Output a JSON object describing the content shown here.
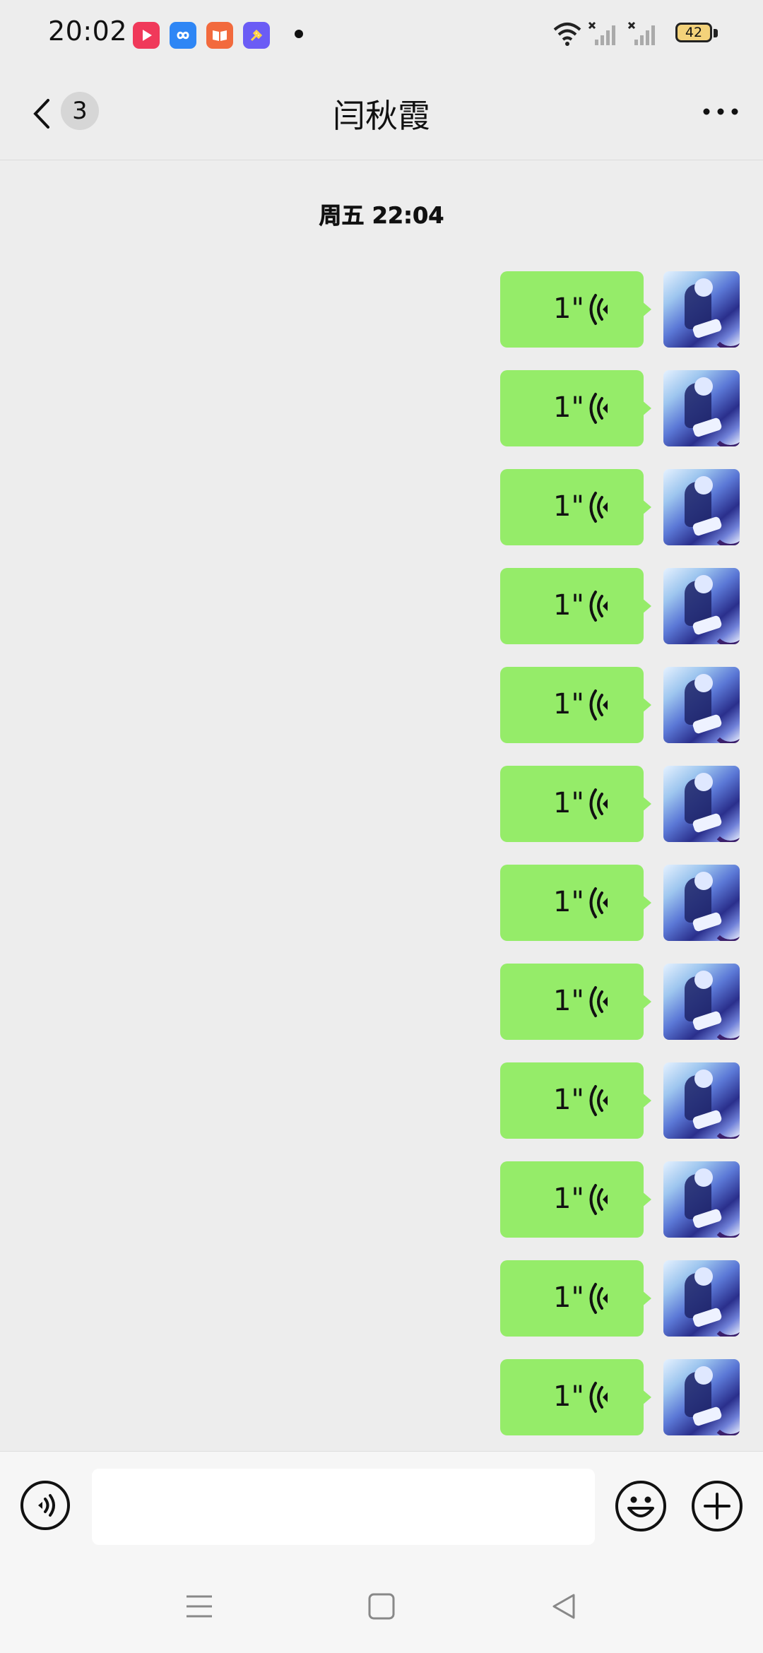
{
  "status_bar": {
    "time": "20:02",
    "battery": "42",
    "apps": [
      {
        "name": "video-app-icon",
        "color": "#f0395a"
      },
      {
        "name": "infinity-app-icon",
        "color": "#2e86f5"
      },
      {
        "name": "book-app-icon",
        "color": "#f26a3d"
      },
      {
        "name": "shortcut-app-icon",
        "color": "#6b5cf5"
      }
    ]
  },
  "header": {
    "unread_count": "3",
    "title": "闫秋霞"
  },
  "chat": {
    "timestamp": "周五 22:04",
    "bubble_color": "#95ec69",
    "messages": [
      {
        "duration": "1\""
      },
      {
        "duration": "1\""
      },
      {
        "duration": "1\""
      },
      {
        "duration": "1\""
      },
      {
        "duration": "1\""
      },
      {
        "duration": "1\""
      },
      {
        "duration": "1\""
      },
      {
        "duration": "1\""
      },
      {
        "duration": "1\""
      },
      {
        "duration": "1\""
      },
      {
        "duration": "1\""
      },
      {
        "duration": "1\""
      }
    ]
  },
  "input": {
    "value": ""
  }
}
